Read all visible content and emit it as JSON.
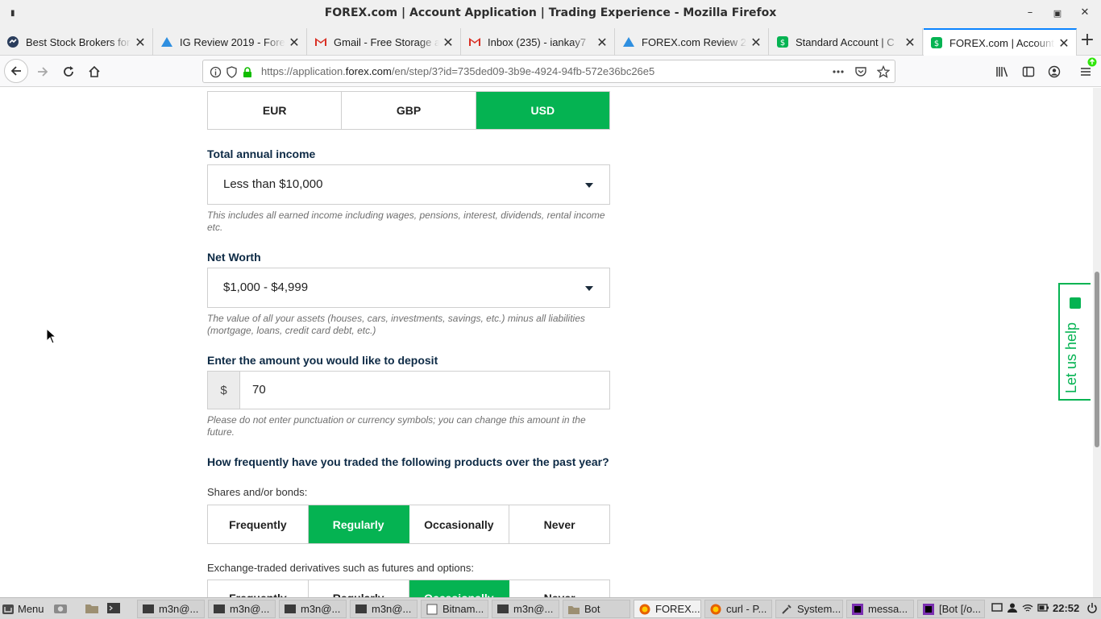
{
  "window": {
    "title": "FOREX.com | Account Application | Trading Experience - Mozilla Firefox"
  },
  "tabs": [
    {
      "label": "Best Stock Brokers for",
      "icon": "broker-icon"
    },
    {
      "label": "IG Review 2019 - Fore",
      "icon": "triangle-icon"
    },
    {
      "label": "Gmail - Free Storage a",
      "icon": "gmail-icon"
    },
    {
      "label": "Inbox (235) - iankay7",
      "icon": "gmail-icon"
    },
    {
      "label": "FOREX.com Review 20",
      "icon": "triangle-icon"
    },
    {
      "label": "Standard Account | C",
      "icon": "forex-icon"
    },
    {
      "label": "FOREX.com | Account",
      "icon": "forex-icon",
      "active": true
    }
  ],
  "navbar": {
    "url_prefix": "https://application.",
    "url_host": "forex.com",
    "url_suffix": "/en/step/3?id=735ded09-3b9e-4924-94fb-572e36bc26e5"
  },
  "form": {
    "currency_options": [
      "EUR",
      "GBP",
      "USD"
    ],
    "currency_selected": "USD",
    "income_label": "Total annual income",
    "income_value": "Less than $10,000",
    "income_hint": "This includes all earned income including wages, pensions, interest, dividends, rental income etc.",
    "networth_label": "Net Worth",
    "networth_value": "$1,000 - $4,999",
    "networth_hint": "The value of all your assets (houses, cars, investments, savings, etc.) minus all liabilities (mortgage, loans, credit card debt, etc.)",
    "deposit_label": "Enter the amount you would like to deposit",
    "deposit_currency": "$",
    "deposit_value": "70",
    "deposit_hint": "Please do not enter punctuation or currency symbols; you can change this amount in the future.",
    "frequency_question": "How frequently have you traded the following products over the past year?",
    "shares_label": "Shares and/or bonds:",
    "frequency_options": [
      "Frequently",
      "Regularly",
      "Occasionally",
      "Never"
    ],
    "shares_selected": "Regularly",
    "derivatives_label": "Exchange-traded derivatives such as futures and options:",
    "derivatives_selected": "Occasionally"
  },
  "help_tab": {
    "label": "Let us help"
  },
  "taskbar": {
    "menu_label": "Menu",
    "tasks": [
      "m3n@...",
      "m3n@...",
      "m3n@...",
      "m3n@...",
      "Bitnam...",
      "m3n@...",
      "Bot",
      "FOREX...",
      "curl - P...",
      "System...",
      "messa...",
      "[Bot [/o..."
    ],
    "clock": "22:52"
  },
  "colors": {
    "accent_green": "#05b352",
    "label_navy": "#0d2a45",
    "firefox_blue": "#0a84ff"
  }
}
